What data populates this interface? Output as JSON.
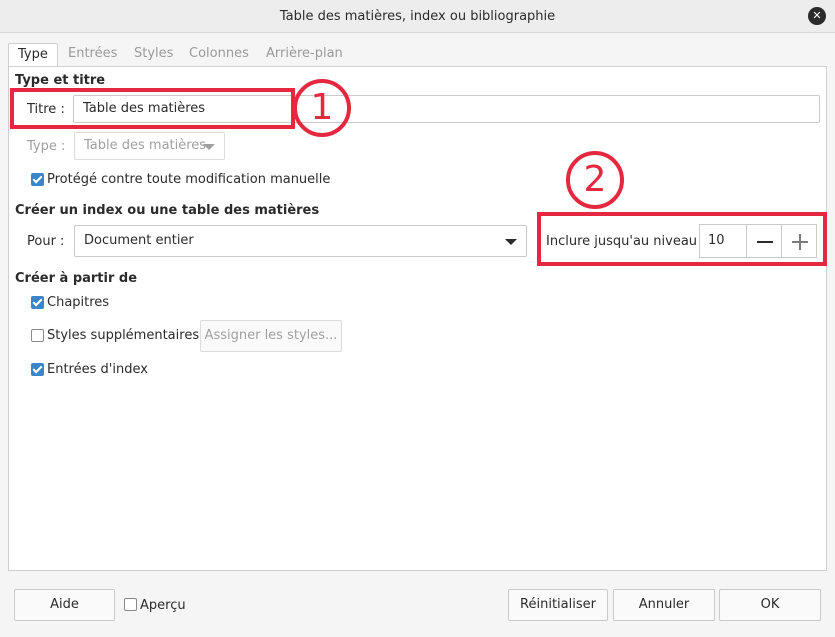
{
  "window": {
    "title": "Table des matières, index ou bibliographie",
    "close_glyph": "✕"
  },
  "tabs": [
    {
      "label": "Type",
      "active": true
    },
    {
      "label": "Entrées",
      "active": false
    },
    {
      "label": "Styles",
      "active": false
    },
    {
      "label": "Colonnes",
      "active": false
    },
    {
      "label": "Arrière-plan",
      "active": false
    }
  ],
  "type_title": {
    "heading": "Type et titre",
    "title_label": "Titre :",
    "title_value": "Table des matières",
    "type_label": "Type :",
    "type_value": "Table des matières",
    "protected_label": "Protégé contre toute modification manuelle",
    "protected_checked": true
  },
  "create_index": {
    "heading": "Créer un index ou une table des matières",
    "for_label": "Pour :",
    "for_value": "Document entier",
    "level_label": "Inclure jusqu'au niveau :",
    "level_value": "10"
  },
  "create_from": {
    "heading": "Créer à partir de",
    "chapters_label": "Chapitres",
    "chapters_checked": true,
    "extra_styles_label": "Styles supplémentaires",
    "extra_styles_checked": false,
    "assign_styles_label": "Assigner les styles...",
    "index_entries_label": "Entrées d'index",
    "index_entries_checked": true
  },
  "footer": {
    "help_label": "Aide",
    "preview_label": "Aperçu",
    "preview_checked": false,
    "reset_label": "Réinitialiser",
    "cancel_label": "Annuler",
    "ok_label": "OK"
  },
  "annotations": {
    "marker_1": "1",
    "marker_2": "2",
    "color": "#e5283f"
  },
  "colors": {
    "accent": "#3b86c9",
    "annotation": "#e5283f"
  }
}
